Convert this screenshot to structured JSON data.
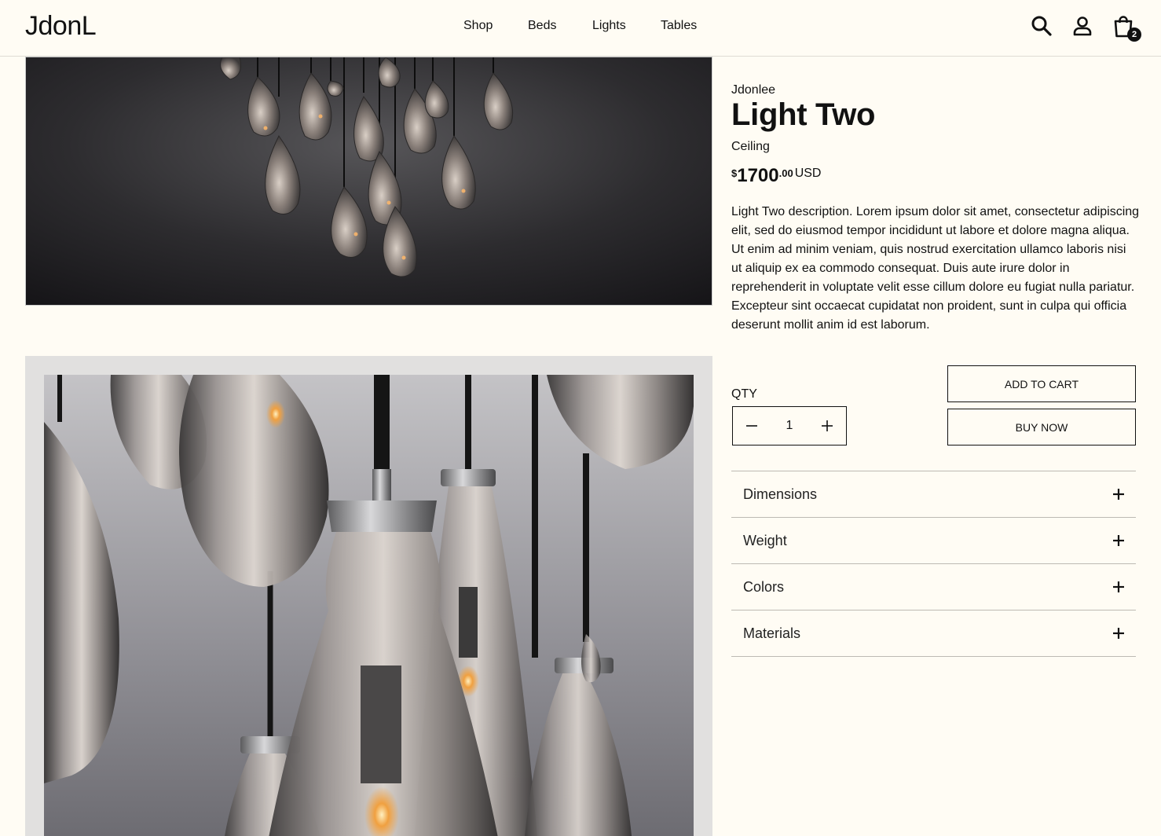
{
  "header": {
    "logo": "JdonL",
    "nav": [
      "Shop",
      "Beds",
      "Lights",
      "Tables"
    ],
    "cart_count": "2"
  },
  "product": {
    "brand": "Jdonlee",
    "title": "Light Two",
    "category": "Ceiling",
    "price": {
      "currency_symbol": "$",
      "integer": "1700",
      "decimal": ".00",
      "code": "USD"
    },
    "description": "Light Two description. Lorem ipsum dolor sit amet, consectetur adipiscing elit, sed do eiusmod tempor incididunt ut labore et dolore magna aliqua. Ut enim ad minim veniam, quis nostrud exercitation ullamco laboris nisi ut aliquip ex ea commodo consequat. Duis aute irure dolor in reprehenderit in voluptate velit esse cillum dolore eu fugiat nulla pariatur. Excepteur sint occaecat cupidatat non proident, sunt in culpa qui officia deserunt mollit anim id est laborum."
  },
  "purchase": {
    "qty_label": "QTY",
    "qty_value": "1",
    "add_to_cart": "ADD TO CART",
    "buy_now": "BUY NOW"
  },
  "accordion": [
    "Dimensions",
    "Weight",
    "Colors",
    "Materials"
  ],
  "colors": {
    "background": "#fffcf4",
    "text": "#111111"
  }
}
